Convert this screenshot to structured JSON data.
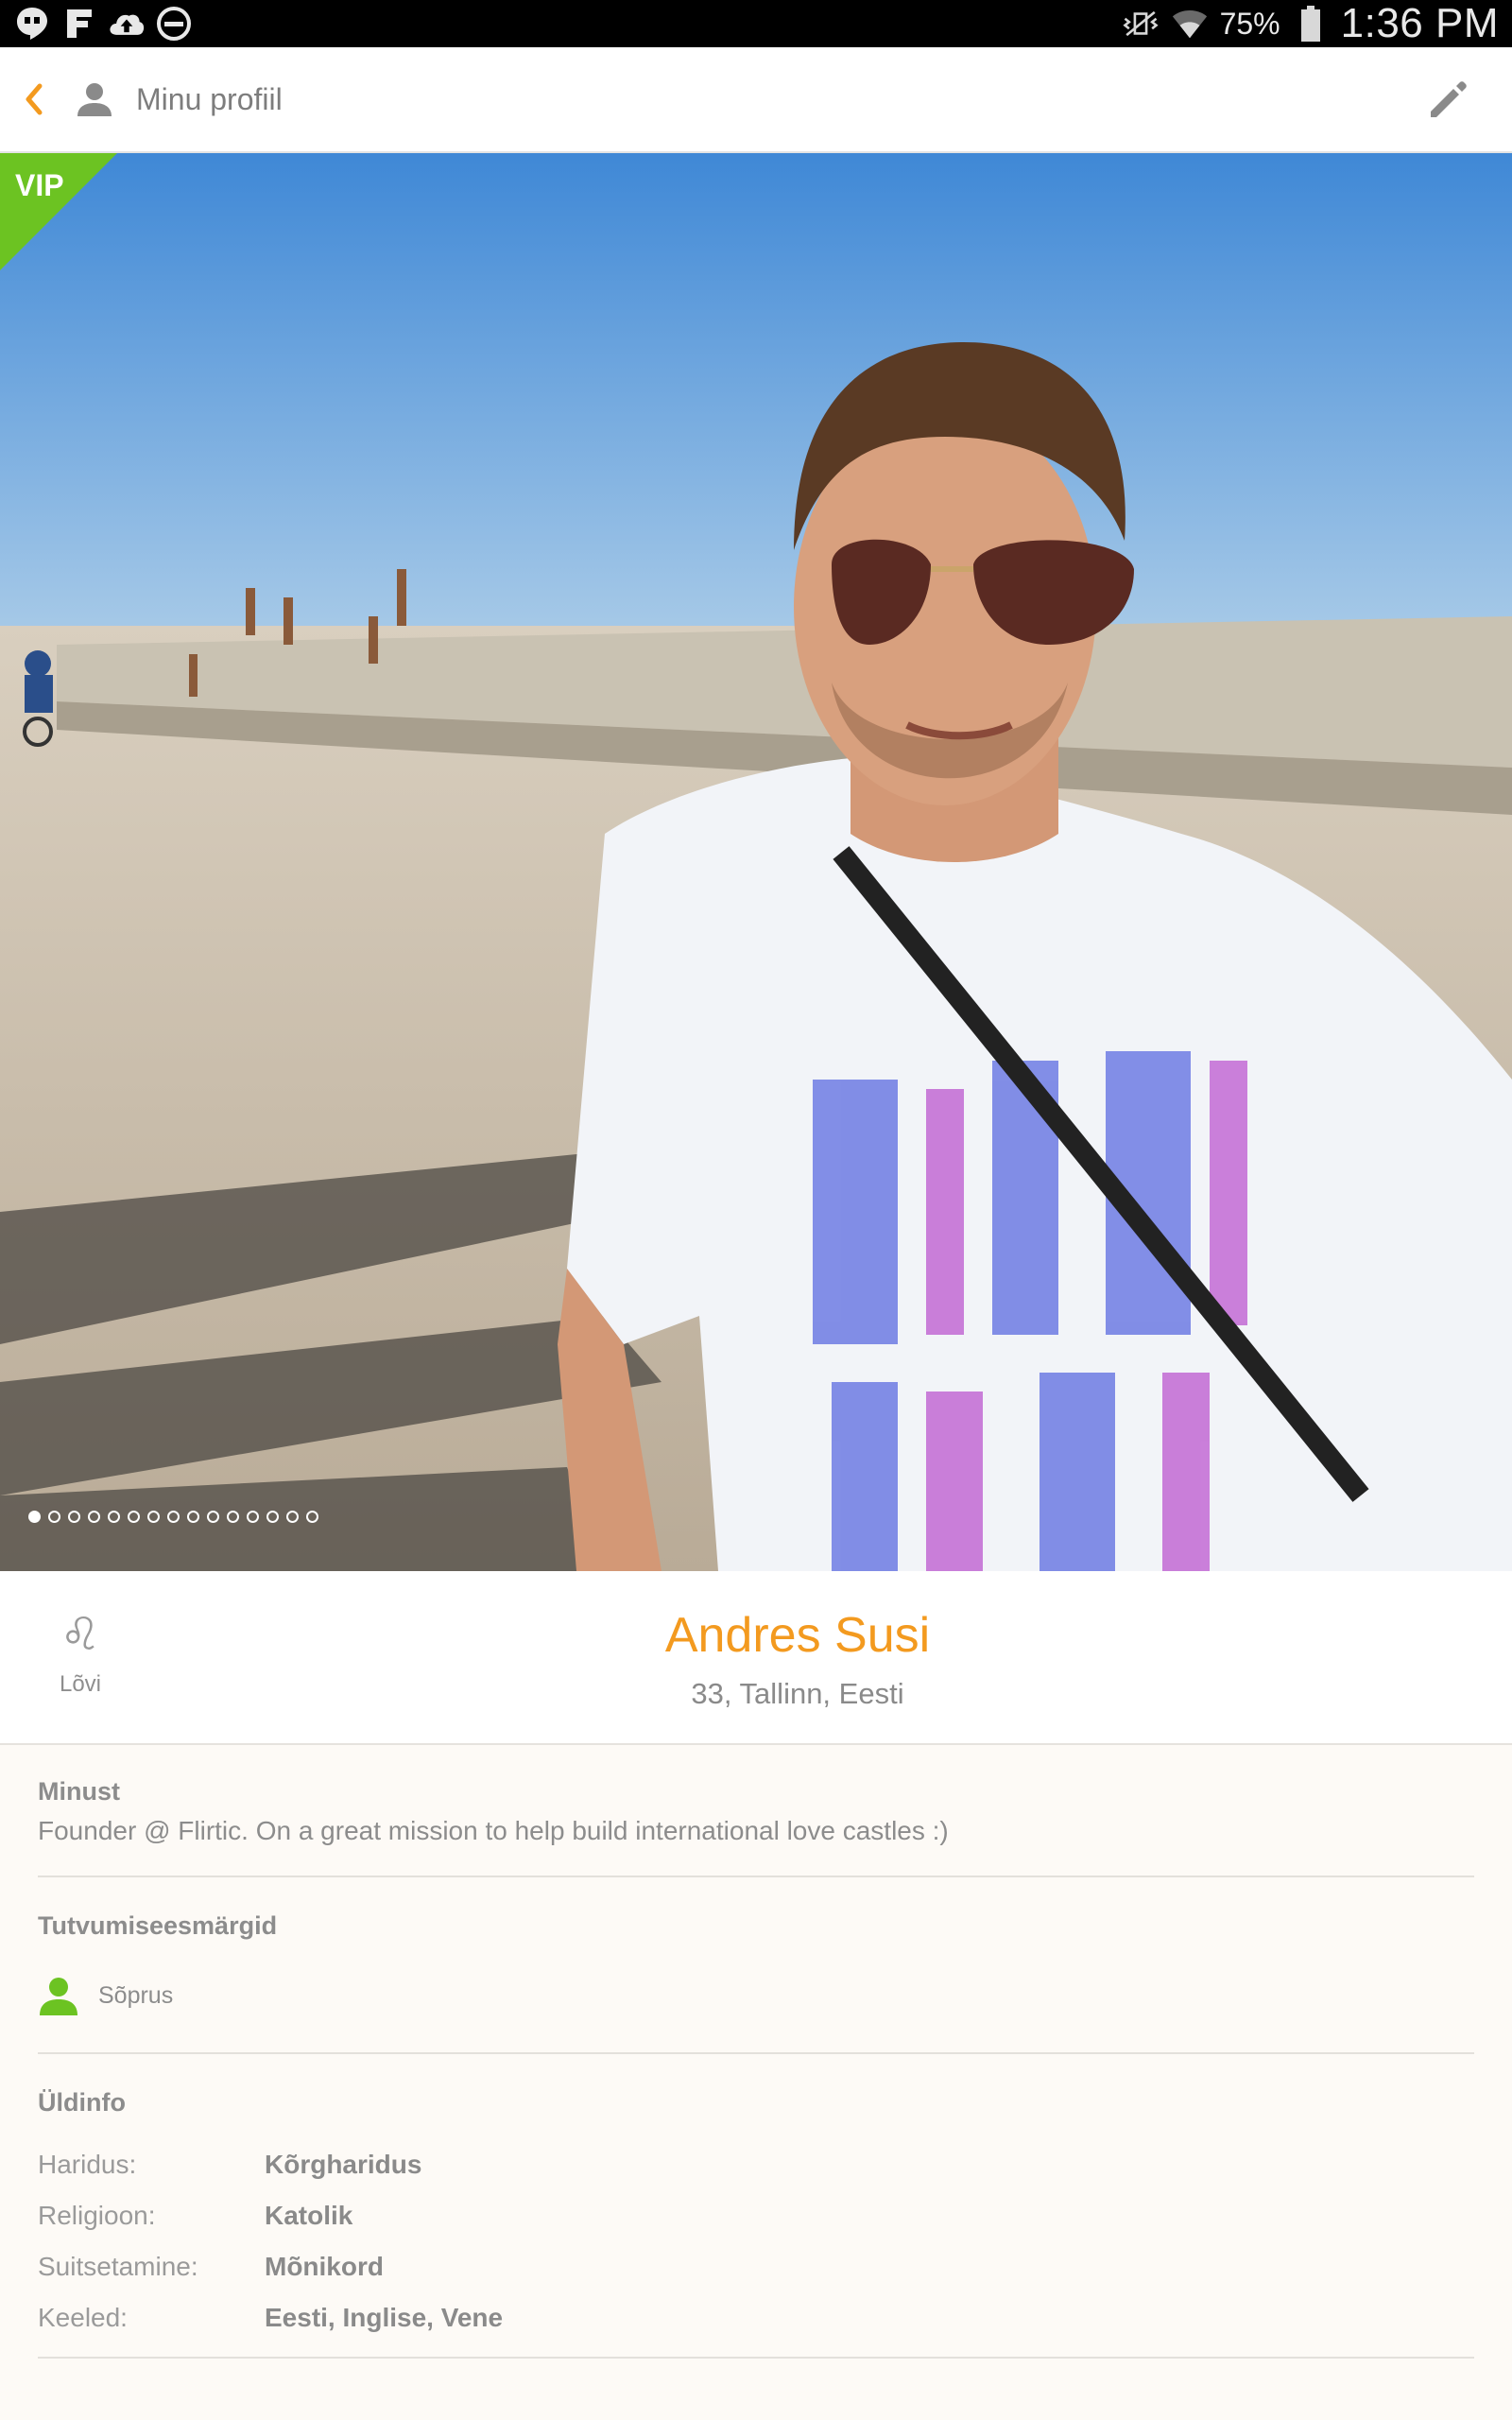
{
  "status_bar": {
    "left_icons": [
      "hangouts-icon",
      "flipboard-icon",
      "cloud-upload-icon",
      "do-not-disturb-icon"
    ],
    "right_icons": [
      "vibrate-icon",
      "wifi-icon",
      "battery-icon"
    ],
    "battery": "75%",
    "time": "1:36 PM"
  },
  "action_bar": {
    "title": "Minu profiil",
    "back_icon": "chevron-left-icon",
    "user_icon": "person-icon",
    "edit_icon": "pencil-icon"
  },
  "photo": {
    "vip_label": "VIP",
    "total_photos": 15,
    "active_index": 0
  },
  "profile": {
    "name": "Andres Susi",
    "subline": "33, Tallinn, Eesti",
    "zodiac_symbol": "♌",
    "zodiac_label": "Lõvi"
  },
  "about": {
    "title": "Minust",
    "text": "Founder @ Flirtic. On a great mission to help build international love castles :)"
  },
  "goals": {
    "title": "Tutvumiseesmärgid",
    "items": [
      {
        "label": "Sõprus",
        "icon": "person-icon"
      }
    ]
  },
  "info": {
    "title": "Üldinfo",
    "rows": [
      {
        "key": "Haridus:",
        "value": "Kõrgharidus"
      },
      {
        "key": "Religioon:",
        "value": "Katolik"
      },
      {
        "key": "Suitsetamine:",
        "value": "Mõnikord"
      },
      {
        "key": "Keeled:",
        "value": "Eesti, Inglise, Vene"
      }
    ]
  },
  "colors": {
    "accent": "#f39a1f",
    "vip_green": "#6cc322",
    "goal_green": "#6cc322",
    "status_bar": "#000000"
  }
}
